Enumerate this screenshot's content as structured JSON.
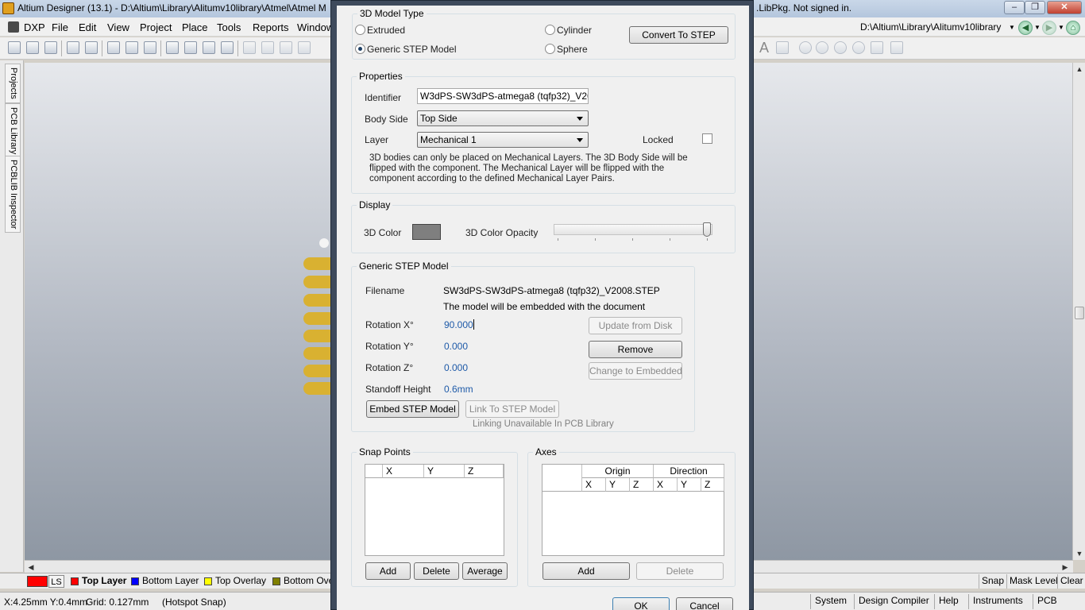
{
  "window": {
    "title": "Altium Designer (13.1) - D:\\Altium\\Library\\Alitumv10library\\Atmel\\Atmel M",
    "title_tail": ".LibPkg. Not signed in."
  },
  "menu": [
    "DXP",
    "File",
    "Edit",
    "View",
    "Project",
    "Place",
    "Tools",
    "Reports",
    "Window"
  ],
  "toolbar": {
    "path": "D:\\Altium\\Library\\Alitumv10library"
  },
  "left_panel": {
    "tabs": [
      "Projects",
      "PCB Library",
      "PCBLIB Inspector"
    ]
  },
  "dialog": {
    "model_type": {
      "title": "3D Model Type",
      "options": {
        "extruded": "Extruded",
        "cylinder": "Cylinder",
        "generic_step": "Generic STEP Model",
        "sphere": "Sphere"
      },
      "selected": "Generic STEP Model",
      "convert_button": "Convert To STEP"
    },
    "properties": {
      "title": "Properties",
      "identifier_label": "Identifier",
      "identifier_value": "W3dPS-SW3dPS-atmega8 (tqfp32)_V2008",
      "body_side_label": "Body Side",
      "body_side_value": "Top Side",
      "layer_label": "Layer",
      "layer_value": "Mechanical 1",
      "locked_label": "Locked",
      "note": "3D bodies can only be placed on Mechanical Layers. The 3D Body Side will be flipped with the component. The Mechanical Layer will be flipped with the component according to the defined Mechanical Layer Pairs."
    },
    "display": {
      "title": "Display",
      "color_label": "3D Color",
      "color_value": "#7f7f7f",
      "opacity_label": "3D Color Opacity",
      "opacity_fraction": 1.0
    },
    "step_model": {
      "title": "Generic STEP Model",
      "filename_label": "Filename",
      "filename_value": "SW3dPS-SW3dPS-atmega8 (tqfp32)_V2008.STEP",
      "embed_note": "The model will be embedded with the document",
      "rotation_x_label": "Rotation X°",
      "rotation_x_value": "90.000",
      "rotation_y_label": "Rotation Y°",
      "rotation_y_value": "0.000",
      "rotation_z_label": "Rotation Z°",
      "rotation_z_value": "0.000",
      "standoff_label": "Standoff Height",
      "standoff_value": "0.6mm",
      "update_button": "Update from Disk",
      "remove_button": "Remove",
      "change_button": "Change to Embedded",
      "embed_button": "Embed STEP Model",
      "link_button": "Link To STEP Model",
      "link_note": "Linking Unavailable In PCB Library"
    },
    "snap_points": {
      "title": "Snap Points",
      "columns": [
        "X",
        "Y",
        "Z"
      ],
      "add": "Add",
      "delete": "Delete",
      "average": "Average"
    },
    "axes": {
      "title": "Axes",
      "group_origin": "Origin",
      "group_direction": "Direction",
      "columns": [
        "X",
        "Y",
        "Z",
        "X",
        "Y",
        "Z"
      ],
      "add": "Add",
      "delete": "Delete"
    },
    "ok": "OK",
    "cancel": "Cancel"
  },
  "layer_bar": {
    "ls": "LS",
    "layers": [
      {
        "name": "Top Layer",
        "color": "#ff0000"
      },
      {
        "name": "Bottom Layer",
        "color": "#0000ff"
      },
      {
        "name": "Top Overlay",
        "color": "#ffff00"
      },
      {
        "name": "Bottom Ove",
        "color": "#808000"
      }
    ],
    "right_buttons": [
      "Snap",
      "Mask Level",
      "Clear"
    ]
  },
  "status_bar": {
    "coords": "X:4.25mm Y:0.4mm",
    "grid": "Grid: 0.127mm",
    "snap": "(Hotspot Snap)",
    "panels": [
      "System",
      "Design Compiler",
      "Help",
      "Instruments",
      "PCB"
    ]
  }
}
